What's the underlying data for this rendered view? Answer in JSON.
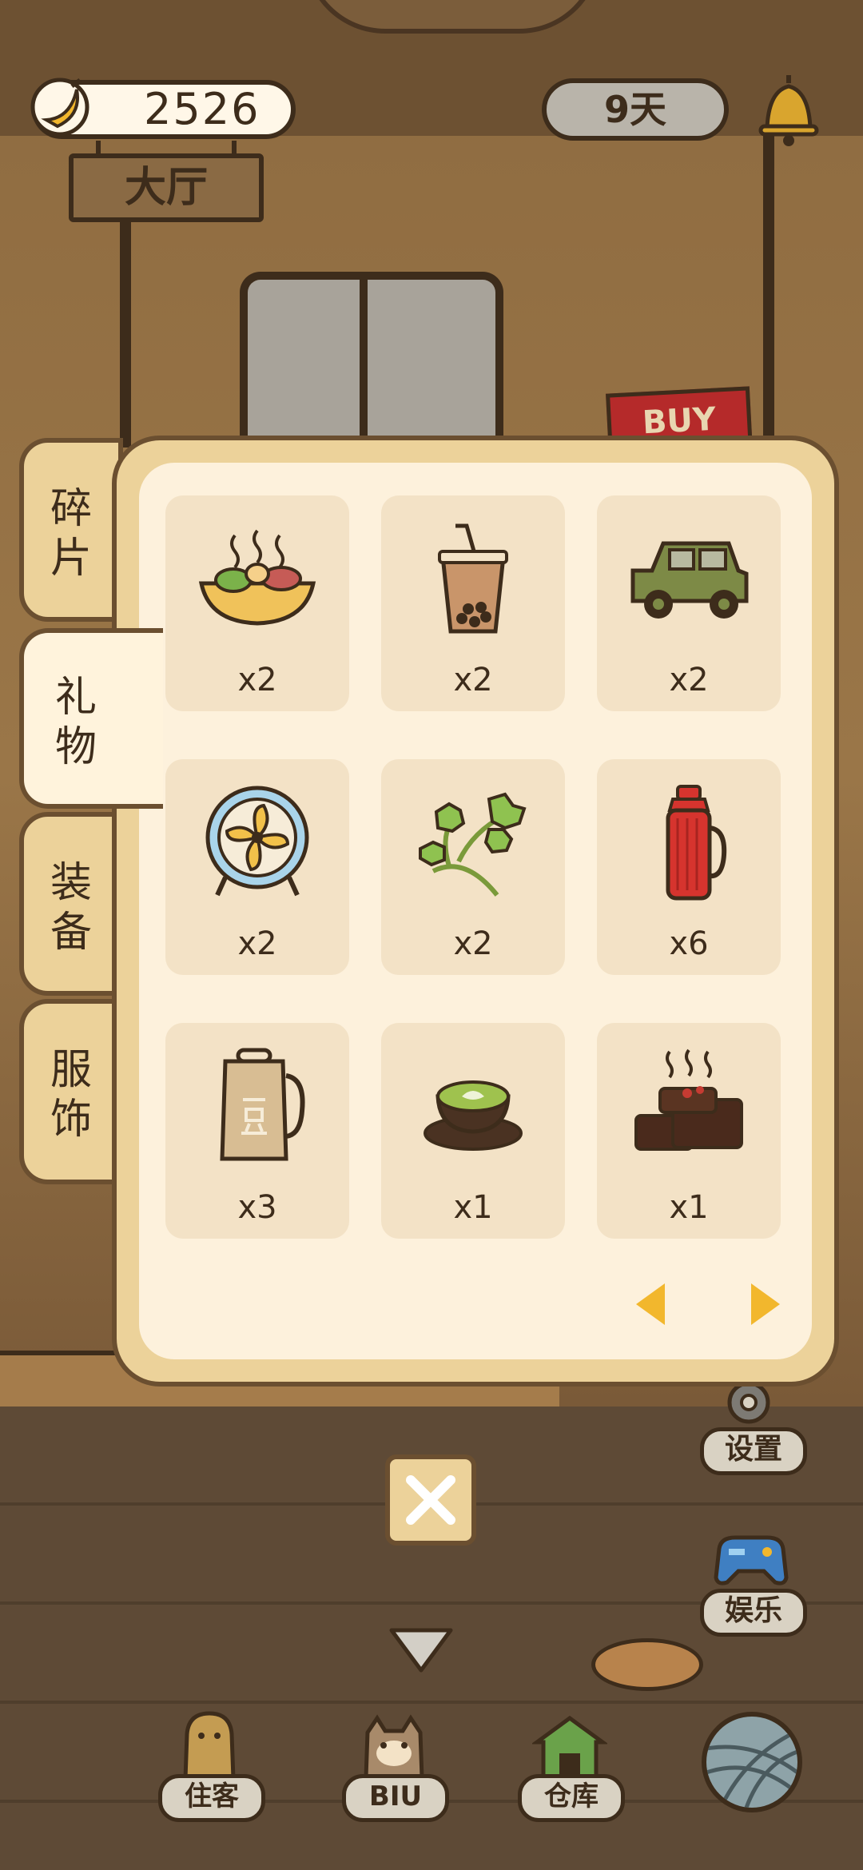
{
  "hud": {
    "currency": "2526",
    "currency_icon": "banana-icon",
    "room_name": "大厅",
    "day_counter": "9天",
    "bell_icon": "bell-icon"
  },
  "scene": {
    "buy_sign": "BUY"
  },
  "inventory": {
    "tabs": [
      {
        "label": "碎片",
        "active": false
      },
      {
        "label": "礼物",
        "active": true
      },
      {
        "label": "装备",
        "active": false
      },
      {
        "label": "服饰",
        "active": false
      }
    ],
    "items": [
      {
        "icon": "hotpot-icon",
        "qty": "x2"
      },
      {
        "icon": "bubble-tea-icon",
        "qty": "x2"
      },
      {
        "icon": "jeep-icon",
        "qty": "x2"
      },
      {
        "icon": "electric-fan-icon",
        "qty": "x2"
      },
      {
        "icon": "cilantro-icon",
        "qty": "x2"
      },
      {
        "icon": "thermos-icon",
        "qty": "x6"
      },
      {
        "icon": "soymilk-maker-icon",
        "qty": "x3"
      },
      {
        "icon": "matcha-latte-icon",
        "qty": "x1"
      },
      {
        "icon": "brownie-icon",
        "qty": "x1"
      }
    ]
  },
  "side_buttons": {
    "settings": "设置",
    "entertainment": "娱乐"
  },
  "bottom_nav": {
    "residents": "住客",
    "biu": "BIU",
    "warehouse": "仓库"
  },
  "colors": {
    "accent": "#f2b72d",
    "panel": "#ecd29a",
    "panel_inner": "#fdf1dc",
    "outline": "#3d2c1b"
  }
}
